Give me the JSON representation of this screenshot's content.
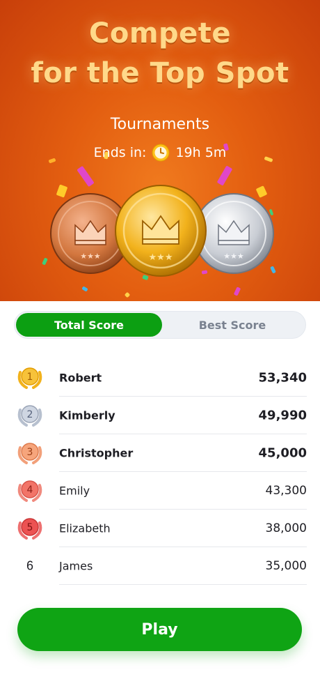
{
  "hero": {
    "title_line1": "Compete",
    "title_line2": "for the Top Spot",
    "subtitle": "Tournaments",
    "ends_label": "Ends in:",
    "ends_time": "19h 5m",
    "clock_icon": "clock-icon",
    "medals": [
      "bronze-crown-medal",
      "gold-crown-medal",
      "silver-crown-medal"
    ]
  },
  "toggle": {
    "options": [
      "Total Score",
      "Best Score"
    ],
    "selected": "Total Score"
  },
  "leaderboard": {
    "rows": [
      {
        "rank": "1",
        "name": "Robert",
        "score": "53,340"
      },
      {
        "rank": "2",
        "name": "Kimberly",
        "score": "49,990"
      },
      {
        "rank": "3",
        "name": "Christopher",
        "score": "45,000"
      },
      {
        "rank": "4",
        "name": "Emily",
        "score": "43,300"
      },
      {
        "rank": "5",
        "name": "Elizabeth",
        "score": "38,000"
      },
      {
        "rank": "6",
        "name": "James",
        "score": "35,000"
      }
    ]
  },
  "play_label": "Play",
  "colors": {
    "accent_green": "#0fa414",
    "hero_orange": "#e35e10",
    "gold": "#f2b21c",
    "silver": "#b7c0cf",
    "bronze": "#f08f62",
    "rank4": "#ee6a5c",
    "rank5": "#e94c4c"
  }
}
